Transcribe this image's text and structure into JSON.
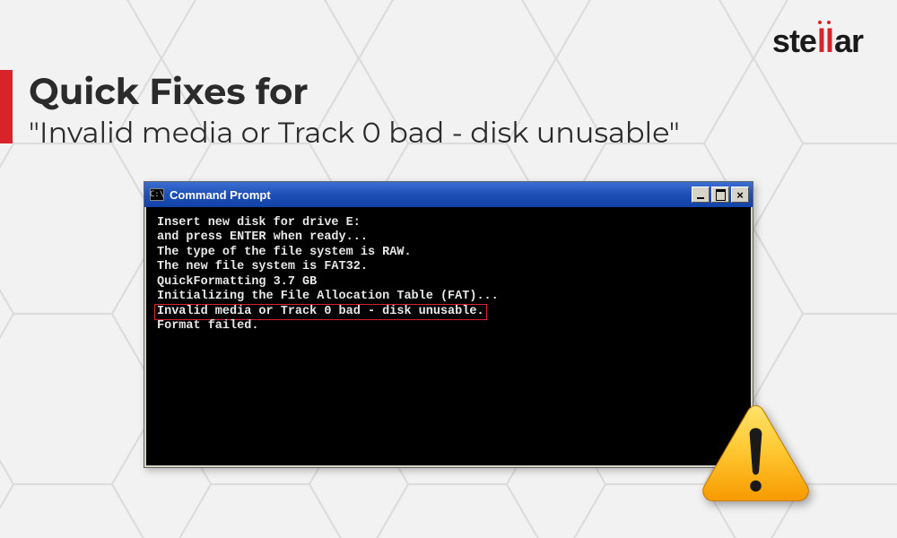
{
  "brand": {
    "name_pre": "ste",
    "name_ll": "ll",
    "name_post": "ar"
  },
  "heading": {
    "main": "Quick Fixes for",
    "sub": "\"Invalid media or Track 0 bad - disk unusable\""
  },
  "window": {
    "title": "Command Prompt",
    "icon_label": "C:\\",
    "buttons": {
      "min": "minimize",
      "max": "maximize",
      "close": "×"
    }
  },
  "terminal": {
    "lines": [
      "Insert new disk for drive E:",
      "and press ENTER when ready...",
      "The type of the file system is RAW.",
      "The new file system is FAT32.",
      "QuickFormatting 3.7 GB",
      "Initializing the File Allocation Table (FAT)..."
    ],
    "highlighted": "Invalid media or Track 0 bad - disk unusable.",
    "after": "Format failed."
  },
  "icons": {
    "warning": "warning-triangle"
  }
}
